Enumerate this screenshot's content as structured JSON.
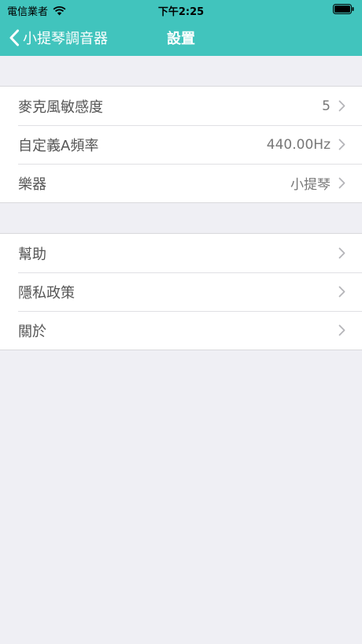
{
  "status_bar": {
    "carrier": "電信業者",
    "time": "下午2:25"
  },
  "navbar": {
    "back_label": "小提琴調音器",
    "title": "設置"
  },
  "settings_group": [
    {
      "label": "麥克風敏感度",
      "value": "5"
    },
    {
      "label": "自定義A頻率",
      "value": "440.00Hz"
    },
    {
      "label": "樂器",
      "value": "小提琴"
    }
  ],
  "info_group": [
    {
      "label": "幫助"
    },
    {
      "label": "隱私政策"
    },
    {
      "label": "關於"
    }
  ],
  "colors": {
    "accent": "#41c4bd",
    "background": "#efeff4"
  }
}
